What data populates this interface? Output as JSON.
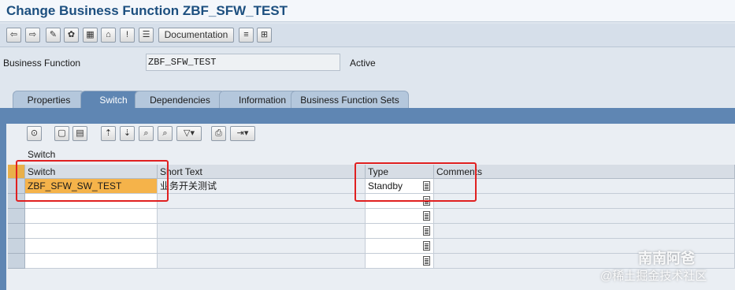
{
  "window": {
    "title": "Change Business Function ZBF_SFW_TEST"
  },
  "toolbar": {
    "documentation_label": "Documentation"
  },
  "business_function": {
    "label": "Business Function",
    "value": "ZBF_SFW_TEST",
    "status": "Active"
  },
  "tabs": [
    {
      "label": "Properties",
      "active": false
    },
    {
      "label": "Switch",
      "active": true
    },
    {
      "label": "Dependencies",
      "active": false
    },
    {
      "label": "Information",
      "active": false
    },
    {
      "label": "Business Function Sets",
      "active": false
    }
  ],
  "table": {
    "title": "Switch",
    "columns": [
      "Switch",
      "Short Text",
      "Type",
      "Comments"
    ],
    "rows": [
      {
        "switch": "ZBF_SFW_SW_TEST",
        "short_text": "业务开关测试",
        "type": "Standby",
        "comments": ""
      },
      {
        "switch": "",
        "short_text": "",
        "type": "",
        "comments": ""
      },
      {
        "switch": "",
        "short_text": "",
        "type": "",
        "comments": ""
      },
      {
        "switch": "",
        "short_text": "",
        "type": "",
        "comments": ""
      },
      {
        "switch": "",
        "short_text": "",
        "type": "",
        "comments": ""
      },
      {
        "switch": "",
        "short_text": "",
        "type": "",
        "comments": ""
      }
    ]
  },
  "watermark": {
    "line1": "南南阿爸",
    "line2": "@稀土掘金技术社区"
  },
  "colors": {
    "title": "#1c4f7f",
    "active_tab": "#5f86b3",
    "highlight_cell": "#f5b34a",
    "annotation_box": "#e02020"
  }
}
